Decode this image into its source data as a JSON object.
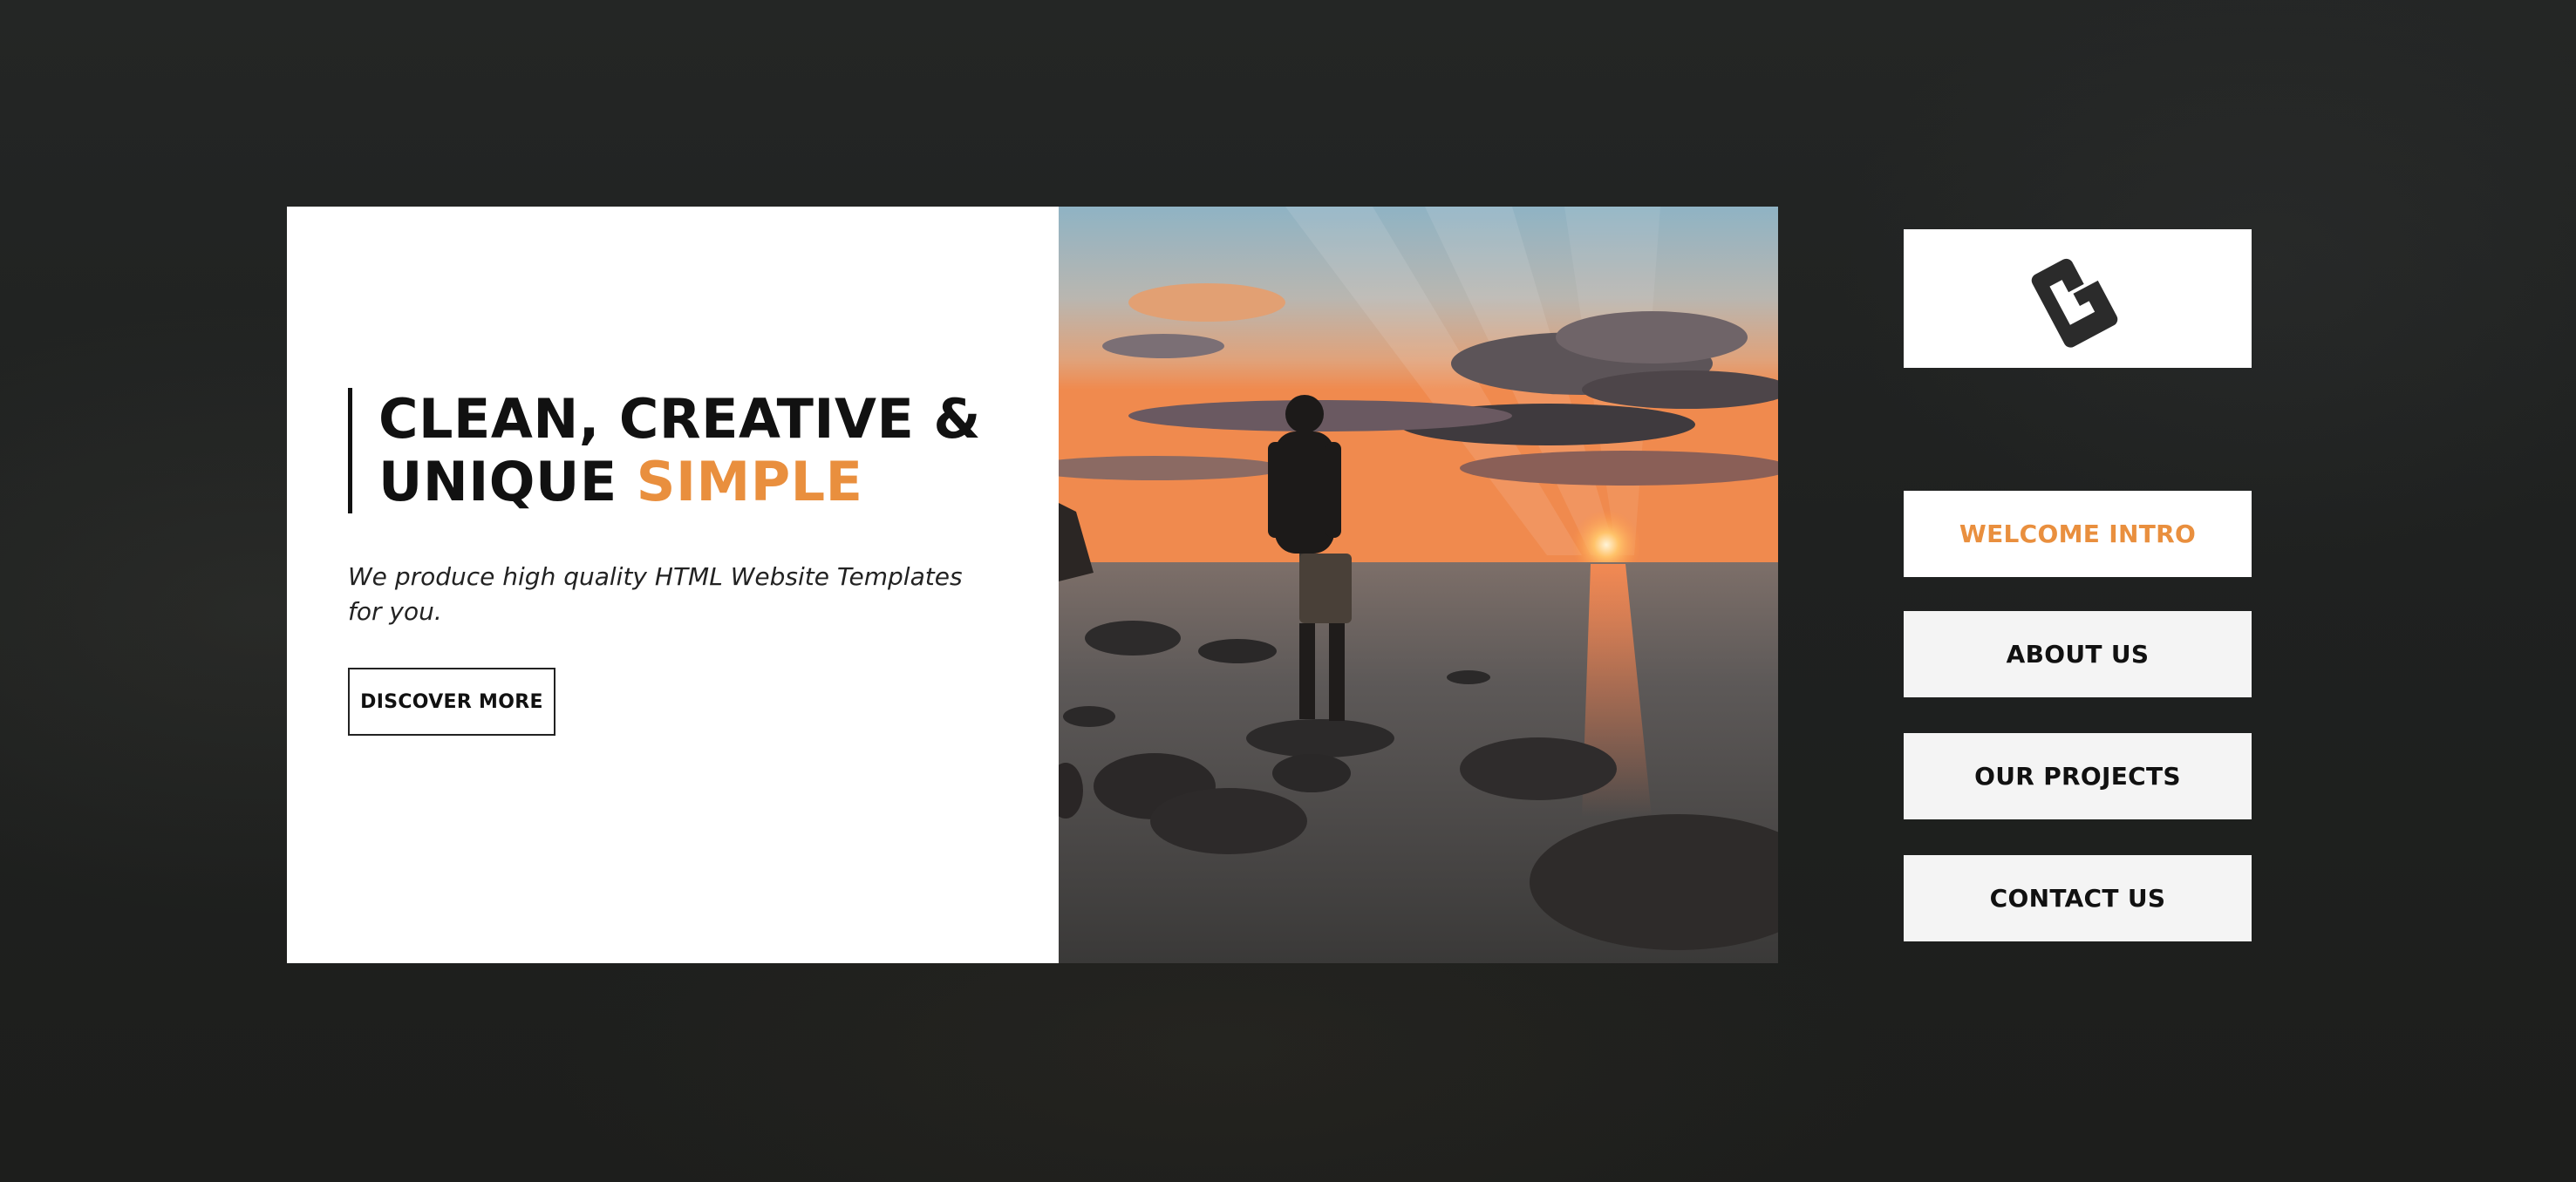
{
  "hero": {
    "headline_line1": "CLEAN, CREATIVE &",
    "headline_line2_prefix": "UNIQUE ",
    "headline_line2_accent": "SIMPLE",
    "description": "We produce high quality HTML Website Templates for you.",
    "cta_label": "DISCOVER MORE",
    "image_icon": "sunset-beach-photo"
  },
  "brand": {
    "logo_icon": "brand-logo-icon"
  },
  "nav": {
    "items": [
      {
        "label": "WELCOME INTRO",
        "active": true
      },
      {
        "label": "ABOUT US",
        "active": false
      },
      {
        "label": "OUR PROJECTS",
        "active": false
      },
      {
        "label": "CONTACT US",
        "active": false
      }
    ]
  },
  "colors": {
    "accent": "#e98f3e",
    "background": "#222423",
    "text": "#111111",
    "nav_background": "#f4f4f4"
  }
}
